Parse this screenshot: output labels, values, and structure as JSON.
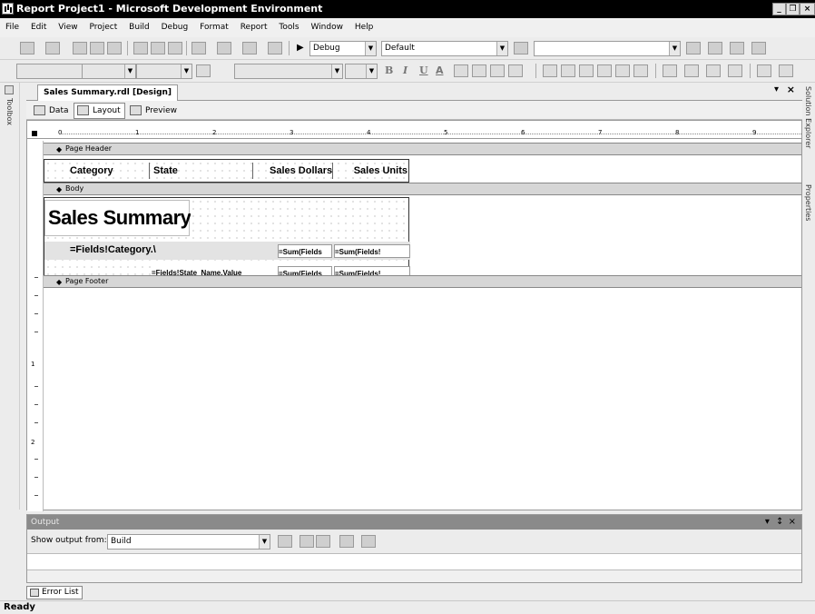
{
  "window": {
    "title": "Report Project1 - Microsoft Development Environment",
    "min": "_",
    "max": "❐",
    "close": "×"
  },
  "menu": [
    "File",
    "Edit",
    "View",
    "Project",
    "Build",
    "Debug",
    "Format",
    "Report",
    "Tools",
    "Window",
    "Help"
  ],
  "toolbar": {
    "run_icon": "▶",
    "config": "Debug",
    "platform": "Default",
    "format_icons": [
      "B",
      "I",
      "U",
      "A"
    ]
  },
  "side_panels": {
    "left": "Toolbox",
    "right_top": "Solution Explorer",
    "right_bottom": "Properties"
  },
  "document": {
    "tab_name": "Sales Summary.rdl [Design]",
    "pin": "▾",
    "close": "×"
  },
  "mode_tabs": [
    "Data",
    "Layout",
    "Preview"
  ],
  "ruler": [
    "0",
    "1",
    "2",
    "3",
    "4",
    "5",
    "6",
    "7",
    "8",
    "9"
  ],
  "vruler": [
    "1",
    "2"
  ],
  "report": {
    "page_header": "Page Header",
    "body": "Body",
    "page_footer": "Page Footer",
    "header_cells": [
      "Category",
      "State",
      "Sales Dollars",
      "Sales Units"
    ],
    "title": "Sales Summary",
    "row1": [
      "=Fields!Category.\\",
      "=Sum(Fields",
      "=Sum(Fields!"
    ],
    "row2": [
      "=Fields!State_Name.Value",
      "=Sum(Fields",
      "=Sum(Fields!"
    ]
  },
  "output": {
    "title": "Output",
    "controls": "▾   ↕  ×",
    "show_from_label": "Show output from:",
    "show_from_value": "Build"
  },
  "error_list": "Error List",
  "status": "Ready"
}
